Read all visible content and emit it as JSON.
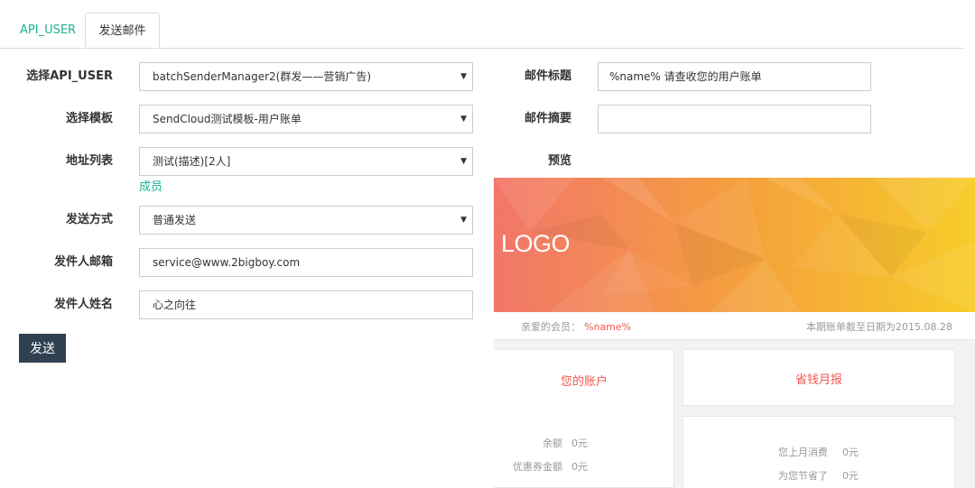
{
  "tabs": [
    {
      "label": "API_USER",
      "active": false
    },
    {
      "label": "发送邮件",
      "active": true
    }
  ],
  "form": {
    "api_user": {
      "label": "选择API_USER",
      "value": "batchSenderManager2(群发——营销广告)"
    },
    "template": {
      "label": "选择模板",
      "value": "SendCloud测试模板-用户账单"
    },
    "address_list": {
      "label": "地址列表",
      "value": "测试(描述)[2人]",
      "members_link": "成员"
    },
    "send_mode": {
      "label": "发送方式",
      "value": "普通发送"
    },
    "sender_email": {
      "label": "发件人邮箱",
      "value": "service@www.2bigboy.com"
    },
    "sender_name": {
      "label": "发件人姓名",
      "value": "心之向往"
    },
    "send_button": "发送"
  },
  "right": {
    "subject": {
      "label": "邮件标题",
      "value": "%name% 请查收您的用户账单"
    },
    "summary": {
      "label": "邮件摘要",
      "value": ""
    },
    "preview_label": "预览"
  },
  "preview": {
    "logo": "LOGO",
    "greeting": "亲爱的会员：",
    "name_var": "%name%",
    "period": "本期账单截至日期为2015.08.28",
    "account_title": "您的账户",
    "savings_title": "省钱月报",
    "account_rows": [
      {
        "key": "余额",
        "value": "0元"
      },
      {
        "key": "优惠券金额",
        "value": "0元"
      }
    ],
    "savings_rows": [
      {
        "key": "您上月消费",
        "value": "0元"
      },
      {
        "key": "为您节省了",
        "value": "0元"
      }
    ]
  },
  "colors": {
    "accent": "#1bb394",
    "button_bg": "#2f4050",
    "highlight": "#f0584f",
    "banner_start": "#f2766a",
    "banner_end": "#f7c52b"
  },
  "icons": {
    "select_caret": "caret-down-icon"
  }
}
